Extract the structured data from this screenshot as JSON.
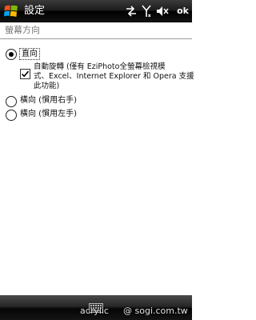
{
  "window": {
    "title": "設定",
    "ok_label": "ok"
  },
  "icons": {
    "start": "windows-start-icon",
    "connectivity": "connectivity-arrows-icon",
    "signal": "signal-antenna-icon",
    "volume": "volume-muted-icon",
    "keyboard": "keyboard-icon"
  },
  "section": {
    "header": "螢幕方向"
  },
  "options": {
    "portrait": {
      "label": "直向",
      "selected": true
    },
    "auto_rotate": {
      "label_lines": [
        "自動旋轉 (僅有 EziPhoto全螢幕檢視模",
        "式、Excel、Internet Explorer 和 Opera 支援",
        "此功能)"
      ],
      "checked": true
    },
    "landscape_right": {
      "label": "橫向 (慣用右手)",
      "selected": false
    },
    "landscape_left": {
      "label": "橫向 (慣用左手)",
      "selected": false
    }
  },
  "watermark": {
    "left": "acrylic",
    "right": "@ sogi.com.tw"
  },
  "colors": {
    "bar_dark": "#111111",
    "text": "#111111",
    "section_header": "#777777",
    "rule": "#9a9a9a"
  }
}
